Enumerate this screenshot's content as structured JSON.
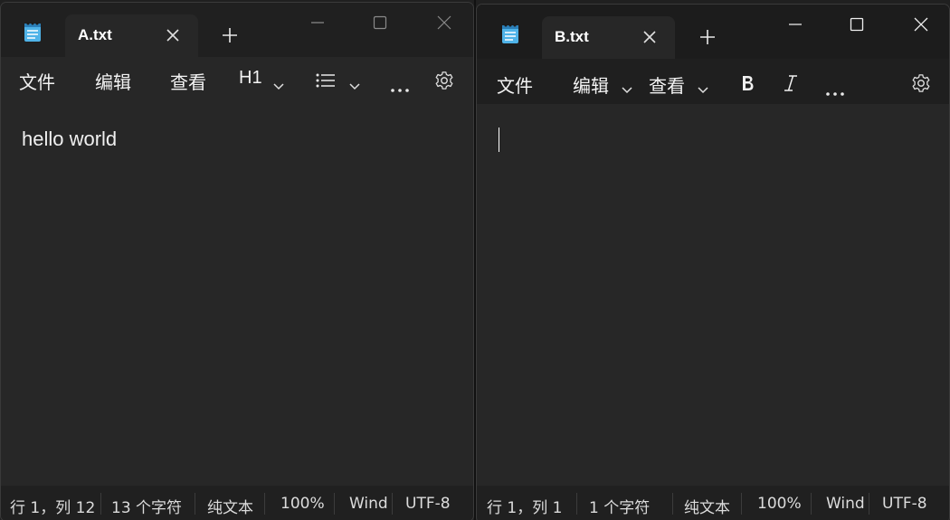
{
  "windows": [
    {
      "tab_title": "A.txt",
      "menu": [
        "文件",
        "编辑",
        "查看"
      ],
      "format_label": "H1",
      "editor_text": "hello world",
      "status": [
        "行 1，列 12",
        "13 个字符",
        "纯文本",
        "100%",
        "Wind",
        "UTF-8"
      ]
    },
    {
      "tab_title": "B.txt",
      "menu": [
        "文件",
        "编辑",
        "查看"
      ],
      "editor_text": "",
      "status": [
        "行 1，列 1",
        "1 个字符",
        "纯文本",
        "100%",
        "Wind",
        "UTF-8"
      ]
    }
  ],
  "icons": {
    "app": "notepad-icon",
    "close_tab": "close-icon",
    "new_tab": "plus-icon",
    "minimize": "minimize-icon",
    "maximize": "maximize-icon",
    "close_window": "close-icon",
    "list": "list-icon",
    "more": "more-icon",
    "settings": "gear-icon",
    "bold": "bold-icon",
    "italic": "italic-icon"
  },
  "colors": {
    "background": "#272727",
    "titlebar": "#202020",
    "text": "#ffffff",
    "app_icon_blue": "#4fb3e8"
  }
}
